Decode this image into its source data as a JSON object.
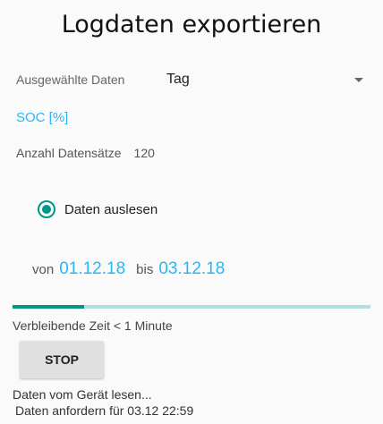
{
  "title": "Logdaten exportieren",
  "selection": {
    "label": "Ausgewählte Daten",
    "value": "Tag"
  },
  "channel": "SOC [%]",
  "record_count": {
    "label": "Anzahl Datensätze",
    "value": "120"
  },
  "mode": {
    "label": "Daten auslesen",
    "selected": true
  },
  "range": {
    "from_label": "von",
    "from_date": "01.12.18",
    "to_label": "bis",
    "to_date": "03.12.18"
  },
  "progress": {
    "fraction": 0.2
  },
  "remaining_time": "Verbleibende Zeit < 1 Minute",
  "stop_label": "STOP",
  "log": {
    "line1": "Daten vom Gerät lesen...",
    "line2": "Daten anfordern für 03.12 22:59"
  },
  "colors": {
    "accent": "#29b6f6",
    "progress": "#009688",
    "progress_track": "#b2dfdb"
  },
  "icons": {
    "dropdown": "caret-down-icon",
    "radio": "radio-selected-icon"
  }
}
